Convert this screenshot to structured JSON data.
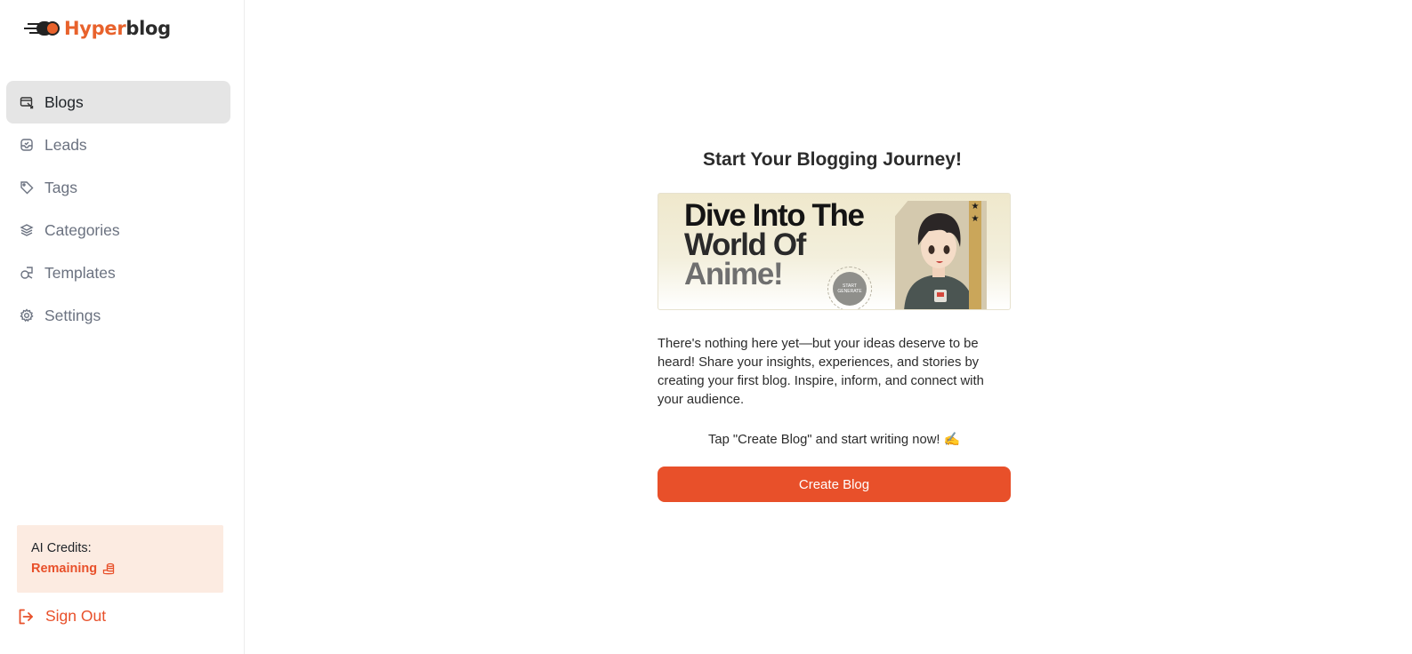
{
  "brand": {
    "name_part1": "Hyper",
    "name_part2": "blog",
    "accent_color": "#e8622c"
  },
  "sidebar": {
    "items": [
      {
        "label": "Blogs",
        "icon": "blog-card-icon",
        "active": true
      },
      {
        "label": "Leads",
        "icon": "inbox-icon",
        "active": false
      },
      {
        "label": "Tags",
        "icon": "tag-icon",
        "active": false
      },
      {
        "label": "Categories",
        "icon": "layers-icon",
        "active": false
      },
      {
        "label": "Templates",
        "icon": "shapes-icon",
        "active": false
      },
      {
        "label": "Settings",
        "icon": "gear-icon",
        "active": false
      }
    ],
    "credits": {
      "label": "AI Credits:",
      "remaining": "Remaining",
      "icon": "coins-icon"
    },
    "sign_out": {
      "label": "Sign Out",
      "icon": "sign-out-icon"
    }
  },
  "main": {
    "headline": "Start Your Blogging Journey!",
    "banner": {
      "line1": "Dive Into The",
      "line2": "World Of",
      "line3": "Anime!",
      "badge_text": "START GENERATE"
    },
    "body": "There's nothing here yet—but your ideas deserve to be heard! Share your insights, experiences, and stories by creating your first blog. Inspire, inform, and connect with your audience.",
    "tap_text": "Tap \"Create Blog\" and start writing now! ✍️",
    "create_button": "Create Blog",
    "button_color": "#e8502a"
  }
}
